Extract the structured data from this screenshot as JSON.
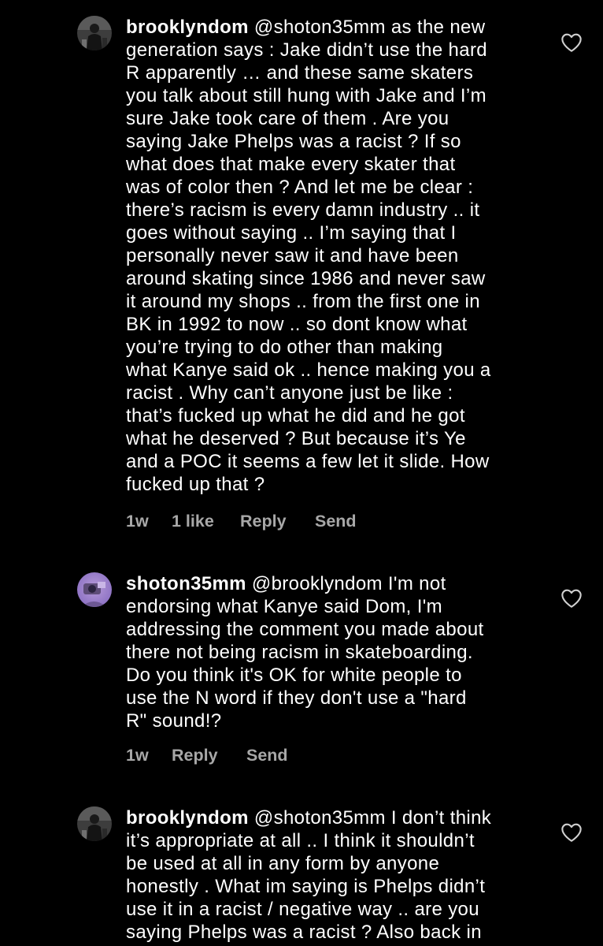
{
  "comments": [
    {
      "username": "brooklyndom",
      "lines": [
        "@shoton35mm as the new",
        "generation says : Jake didn’t use the hard",
        "R apparently … and these same skaters",
        "you talk about still hung with Jake and I’m",
        "sure Jake took care of them . Are you",
        "saying Jake Phelps was a racist ? If so",
        "what does that make every skater that",
        "was of color then ? And let me be clear :",
        "there’s racism is every damn industry .. it",
        "goes without saying .. I’m saying that I",
        "personally never saw it and have been",
        "around skating since 1986 and never saw",
        "it around my shops .. from the first one in",
        "BK in 1992 to now .. so dont know what",
        "you’re trying to do other than making",
        "what Kanye said ok .. hence making you a",
        "racist . Why can’t anyone just be like :",
        "that’s fucked up what he did and he got",
        "what he deserved ? But because it’s Ye",
        "and a POC it seems a few let it slide. How",
        "fucked up that ?"
      ],
      "time": "1w",
      "likes": "1 like",
      "reply": "Reply",
      "send": "Send"
    },
    {
      "username": "shoton35mm",
      "lines": [
        "@brooklyndom I'm not",
        "endorsing what Kanye said Dom, I'm",
        "addressing the comment you made about",
        "there not being racism in skateboarding.",
        "Do you think it's OK for white people to",
        "use the N word if they don't use a \"hard",
        "R\" sound!?"
      ],
      "time": "1w",
      "reply": "Reply",
      "send": "Send"
    },
    {
      "username": "brooklyndom",
      "lines": [
        "@shoton35mm I don’t think",
        "it’s appropriate at all .. I think it shouldn’t",
        "be used at all in any form by anyone",
        "honestly . What im saying is Phelps didn’t",
        "use it in a racist / negative way .. are you",
        "saying Phelps was a racist ? Also back in"
      ]
    }
  ],
  "icons": {
    "like": "heart-outline-icon"
  },
  "colors": {
    "background": "#000000",
    "text": "#ffffff",
    "secondary": "#a8a8a8"
  }
}
